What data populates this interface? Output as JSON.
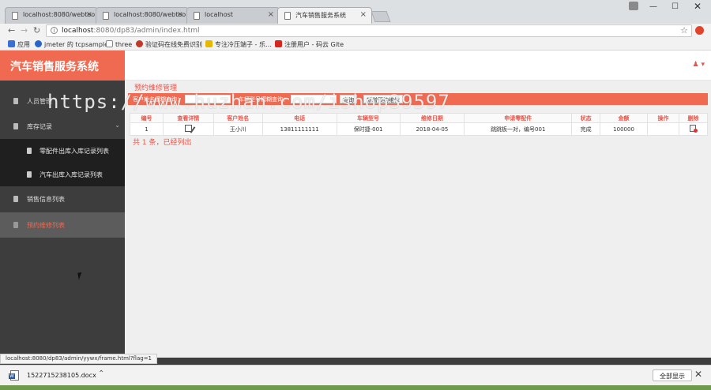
{
  "browser": {
    "tabs": [
      {
        "title": "localhost:8080/webtoo"
      },
      {
        "title": "localhost:8080/webtoo"
      },
      {
        "title": "localhost"
      },
      {
        "title": "汽车销售服务系统"
      }
    ],
    "address": {
      "host": "localhost",
      "path": ":8080/dp83/admin/index.html"
    },
    "bookmarks": [
      {
        "label": "应用",
        "color": "#3a6fd8"
      },
      {
        "label": "jmeter 的 tcpsample",
        "color": "#2a64c8"
      },
      {
        "label": "three",
        "color": "#555555"
      },
      {
        "label": "验证码在线免费识别",
        "color": "#c0392b"
      },
      {
        "label": "专注冷压端子 - 乐…",
        "color": "#e6b800"
      },
      {
        "label": "注册用户 - 码云 Gite",
        "color": "#d7261e"
      }
    ]
  },
  "app": {
    "title": "汽车销售服务系统",
    "user_icon": "user-icon",
    "sidebar": {
      "items": [
        {
          "label": "人员管理"
        },
        {
          "label": "库存记录"
        },
        {
          "label": "零配件出库入库记录列表"
        },
        {
          "label": "汽车出库入库记录列表"
        },
        {
          "label": "销售信息列表"
        },
        {
          "label": "预约维修列表"
        }
      ]
    },
    "page": {
      "title": "预约维修管理",
      "filters": {
        "customer_label": "客户姓名模糊查询：",
        "model_label": "车辆型号模糊查询：",
        "search_button": "查询",
        "add_button": "新增预约维修"
      },
      "table": {
        "headers": [
          "编号",
          "查看详情",
          "客户姓名",
          "电话",
          "车辆型号",
          "维修日期",
          "申请零配件",
          "状态",
          "金额",
          "操作",
          "删除"
        ],
        "rows": [
          {
            "id": "1",
            "customer": "王小川",
            "phone": "13811111111",
            "model": "保时捷-001",
            "date": "2018-04-05",
            "parts": "跳跳板一对，编号001",
            "status": "完成",
            "amount": "100000",
            "action": ""
          }
        ]
      },
      "summary": "共 1 条，已经列出"
    }
  },
  "statusbar": {
    "url": "localhost:8080/dp83/admin/yywx/frame.html?flag=1"
  },
  "downloads": {
    "file": "1522715238105.docx",
    "show_all": "全部显示"
  },
  "watermark": "https://www.huzhan.com/ishop39597"
}
